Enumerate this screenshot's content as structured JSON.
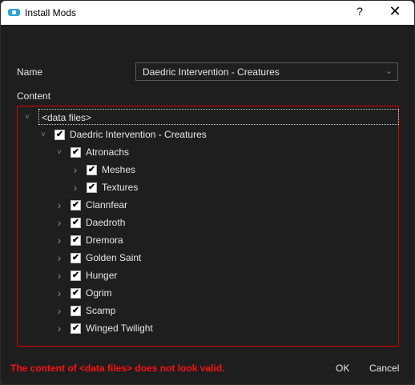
{
  "window": {
    "title": "Install Mods",
    "help": "?",
    "close": "✕"
  },
  "form": {
    "name_label": "Name",
    "name_value": "Daedric Intervention - Creatures",
    "content_label": "Content"
  },
  "tree": [
    {
      "label": "<data files>",
      "level": 0,
      "expanded": true,
      "checkbox": false
    },
    {
      "label": "Daedric Intervention - Creatures",
      "level": 1,
      "expanded": true,
      "checkbox": true
    },
    {
      "label": "Atronachs",
      "level": 2,
      "expanded": true,
      "checkbox": true
    },
    {
      "label": "Meshes",
      "level": 3,
      "expanded": false,
      "checkbox": true
    },
    {
      "label": "Textures",
      "level": 3,
      "expanded": false,
      "checkbox": true
    },
    {
      "label": "Clannfear",
      "level": 2,
      "expanded": false,
      "checkbox": true
    },
    {
      "label": "Daedroth",
      "level": 2,
      "expanded": false,
      "checkbox": true
    },
    {
      "label": "Dremora",
      "level": 2,
      "expanded": false,
      "checkbox": true
    },
    {
      "label": "Golden Saint",
      "level": 2,
      "expanded": false,
      "checkbox": true
    },
    {
      "label": "Hunger",
      "level": 2,
      "expanded": false,
      "checkbox": true
    },
    {
      "label": "Ogrim",
      "level": 2,
      "expanded": false,
      "checkbox": true
    },
    {
      "label": "Scamp",
      "level": 2,
      "expanded": false,
      "checkbox": true
    },
    {
      "label": "Winged Twilight",
      "level": 2,
      "expanded": false,
      "checkbox": true
    }
  ],
  "footer": {
    "error": "The content of <data files> does not look valid.",
    "ok": "OK",
    "cancel": "Cancel"
  },
  "colors": {
    "error": "#ff1010",
    "accent": "#2fa3d8"
  }
}
